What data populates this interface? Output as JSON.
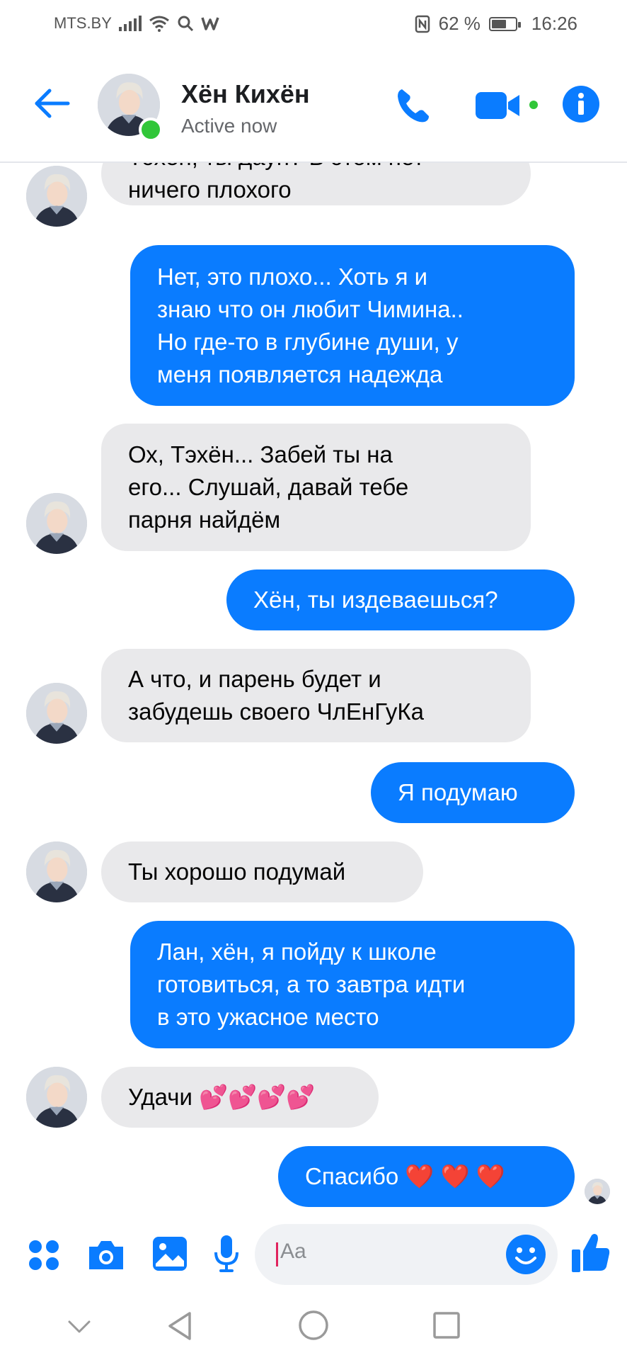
{
  "status_bar": {
    "carrier": "MTS.BY",
    "battery_percent": "62 %",
    "battery_level": 0.62,
    "time": "16:26"
  },
  "header": {
    "contact_name": "Хён Кихён",
    "presence": "Active now"
  },
  "messages": [
    {
      "dir": "in",
      "lines": [
        "Тэхён, ты даун? В этом нет",
        "ничего плохого"
      ],
      "avatar": true
    },
    {
      "dir": "out",
      "lines": [
        "Нет, это плохо... Хоть я и",
        "знаю что он любит Чимина..",
        "Но где-то в глубине души, у",
        "меня появляется надежда"
      ]
    },
    {
      "dir": "in",
      "lines": [
        "Ох, Тэхён... Забей ты на",
        "его... Слушай, давай тебе",
        "парня найдём"
      ],
      "avatar": true
    },
    {
      "dir": "out",
      "lines": [
        "Хён, ты издеваешься?"
      ]
    },
    {
      "dir": "in",
      "lines": [
        "А что, и парень будет и",
        "забудешь своего ЧлЕнГуКа"
      ],
      "avatar": true
    },
    {
      "dir": "out",
      "lines": [
        "Я подумаю"
      ]
    },
    {
      "dir": "in",
      "lines": [
        "Ты хорошо подумай"
      ],
      "avatar": true
    },
    {
      "dir": "out",
      "lines": [
        "Лан, хён, я пойду к школе",
        "готовиться, а то завтра идти",
        "в это ужасное место"
      ]
    },
    {
      "dir": "in",
      "lines": [
        "Удачи 💕💕💕💕"
      ],
      "avatar": true
    },
    {
      "dir": "out",
      "lines": [
        "Спасибо ❤️ ❤️ ❤️"
      ],
      "seen": true
    }
  ],
  "composer": {
    "placeholder": "Aa"
  },
  "colors": {
    "accent": "#0a7cff",
    "incoming_bubble": "#e9e9eb",
    "online": "#31c639"
  },
  "icons": {
    "back": "arrow-left-icon",
    "call": "phone-icon",
    "video": "video-camera-icon",
    "info": "info-icon",
    "more": "four-dots-icon",
    "camera": "camera-icon",
    "gallery": "image-icon",
    "mic": "microphone-icon",
    "emoji": "smiley-icon",
    "like": "thumbs-up-icon",
    "nav_down": "chevron-down-icon",
    "nav_back": "triangle-back-icon",
    "nav_home": "circle-home-icon",
    "nav_recent": "square-recents-icon"
  }
}
